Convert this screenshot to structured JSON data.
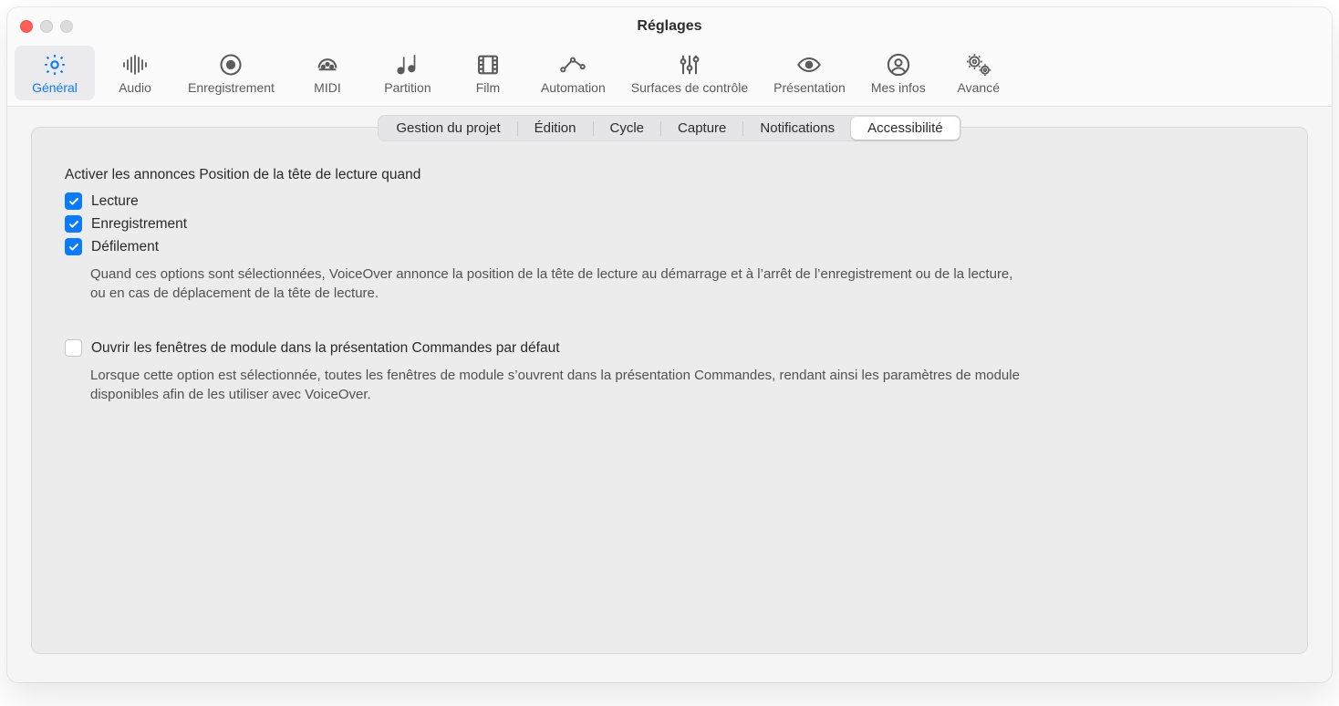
{
  "window": {
    "title": "Réglages"
  },
  "toolbar": {
    "selected": "general",
    "items": {
      "general": {
        "label": "Général"
      },
      "audio": {
        "label": "Audio"
      },
      "record": {
        "label": "Enregistrement"
      },
      "midi": {
        "label": "MIDI"
      },
      "score": {
        "label": "Partition"
      },
      "film": {
        "label": "Film"
      },
      "automation": {
        "label": "Automation"
      },
      "surfaces": {
        "label": "Surfaces de contrôle"
      },
      "display": {
        "label": "Présentation"
      },
      "myinfo": {
        "label": "Mes infos"
      },
      "advanced": {
        "label": "Avancé"
      }
    }
  },
  "segmented": {
    "active": "accessibilite",
    "items": {
      "project": {
        "label": "Gestion du projet"
      },
      "editing": {
        "label": "Édition"
      },
      "cycle": {
        "label": "Cycle"
      },
      "capture": {
        "label": "Capture"
      },
      "notifications": {
        "label": "Notifications"
      },
      "accessibilite": {
        "label": "Accessibilité"
      }
    }
  },
  "form": {
    "section1": {
      "title": "Activer les annonces Position de la tête de lecture quand",
      "options": {
        "playback": {
          "label": "Lecture",
          "checked": true
        },
        "recording": {
          "label": "Enregistrement",
          "checked": true
        },
        "scrubbing": {
          "label": "Défilement",
          "checked": true
        }
      },
      "help": "Quand ces options sont sélectionnées, VoiceOver annonce la position de la tête de lecture au démarrage et à l’arrêt de l’enregistrement ou de la lecture, ou en cas de déplacement de la tête de lecture."
    },
    "section2": {
      "option": {
        "label": "Ouvrir les fenêtres de module dans la présentation Commandes par défaut",
        "checked": false
      },
      "help": "Lorsque cette option est sélectionnée, toutes les fenêtres de module s’ouvrent dans la présentation Commandes, rendant ainsi les paramètres de module disponibles afin de les utiliser avec VoiceOver."
    }
  }
}
